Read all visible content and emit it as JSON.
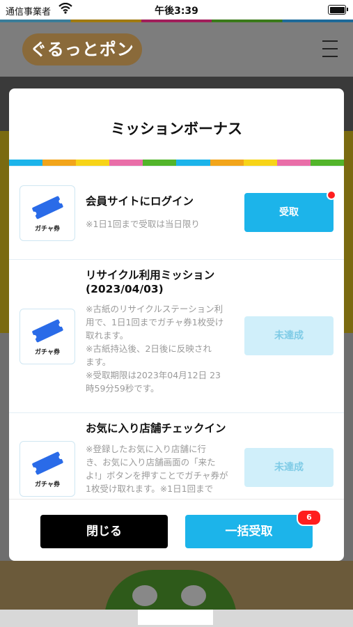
{
  "status_bar": {
    "carrier": "通信事業者",
    "time": "午後3:39"
  },
  "app": {
    "logo_text": "ぐるっとポン"
  },
  "modal": {
    "title": "ミッションボーナス",
    "stripe_colors": [
      "#1cb4ea",
      "#f2a51b",
      "#f7d418",
      "#e96ea8",
      "#52b52b",
      "#1cb4ea",
      "#f2a51b",
      "#f7d418",
      "#e96ea8",
      "#52b52b"
    ],
    "missions": [
      {
        "ticket_label": "ガチャ券",
        "title": "会員サイトにログイン",
        "description": "※1日1回まで受取は当日限り",
        "button": "受取",
        "status": "available"
      },
      {
        "ticket_label": "ガチャ券",
        "title_line1": "リサイクル利用ミッション",
        "title_line2": "(2023/04/03)",
        "desc_lines": [
          "※古紙のリサイクルステーション利",
          "用で、1日1回までガチャ券1枚受け",
          "取れます。",
          "※古紙持込後、2日後に反映され",
          "ます。",
          "※受取期限は2023年04月12日 23",
          "時59分59秒です。"
        ],
        "button": "未達成",
        "status": "incomplete"
      },
      {
        "ticket_label": "ガチャ券",
        "title": "お気に入り店舗チェックイン",
        "desc_lines": [
          "※登録したお気に入り店舗に行",
          "き、お気に入り店舗画面の「来た",
          "よ!」ボタンを押すことでガチャ券が",
          "1枚受け取れます。※1日1回まで"
        ],
        "button": "未達成",
        "status": "incomplete"
      }
    ],
    "footer": {
      "close_label": "閉じる",
      "claim_all_label": "一括受取",
      "claim_all_badge": "6"
    }
  },
  "colors": {
    "accent": "#1cb4ea",
    "disabled": "#d0effa",
    "badge": "#ff1e1e"
  }
}
